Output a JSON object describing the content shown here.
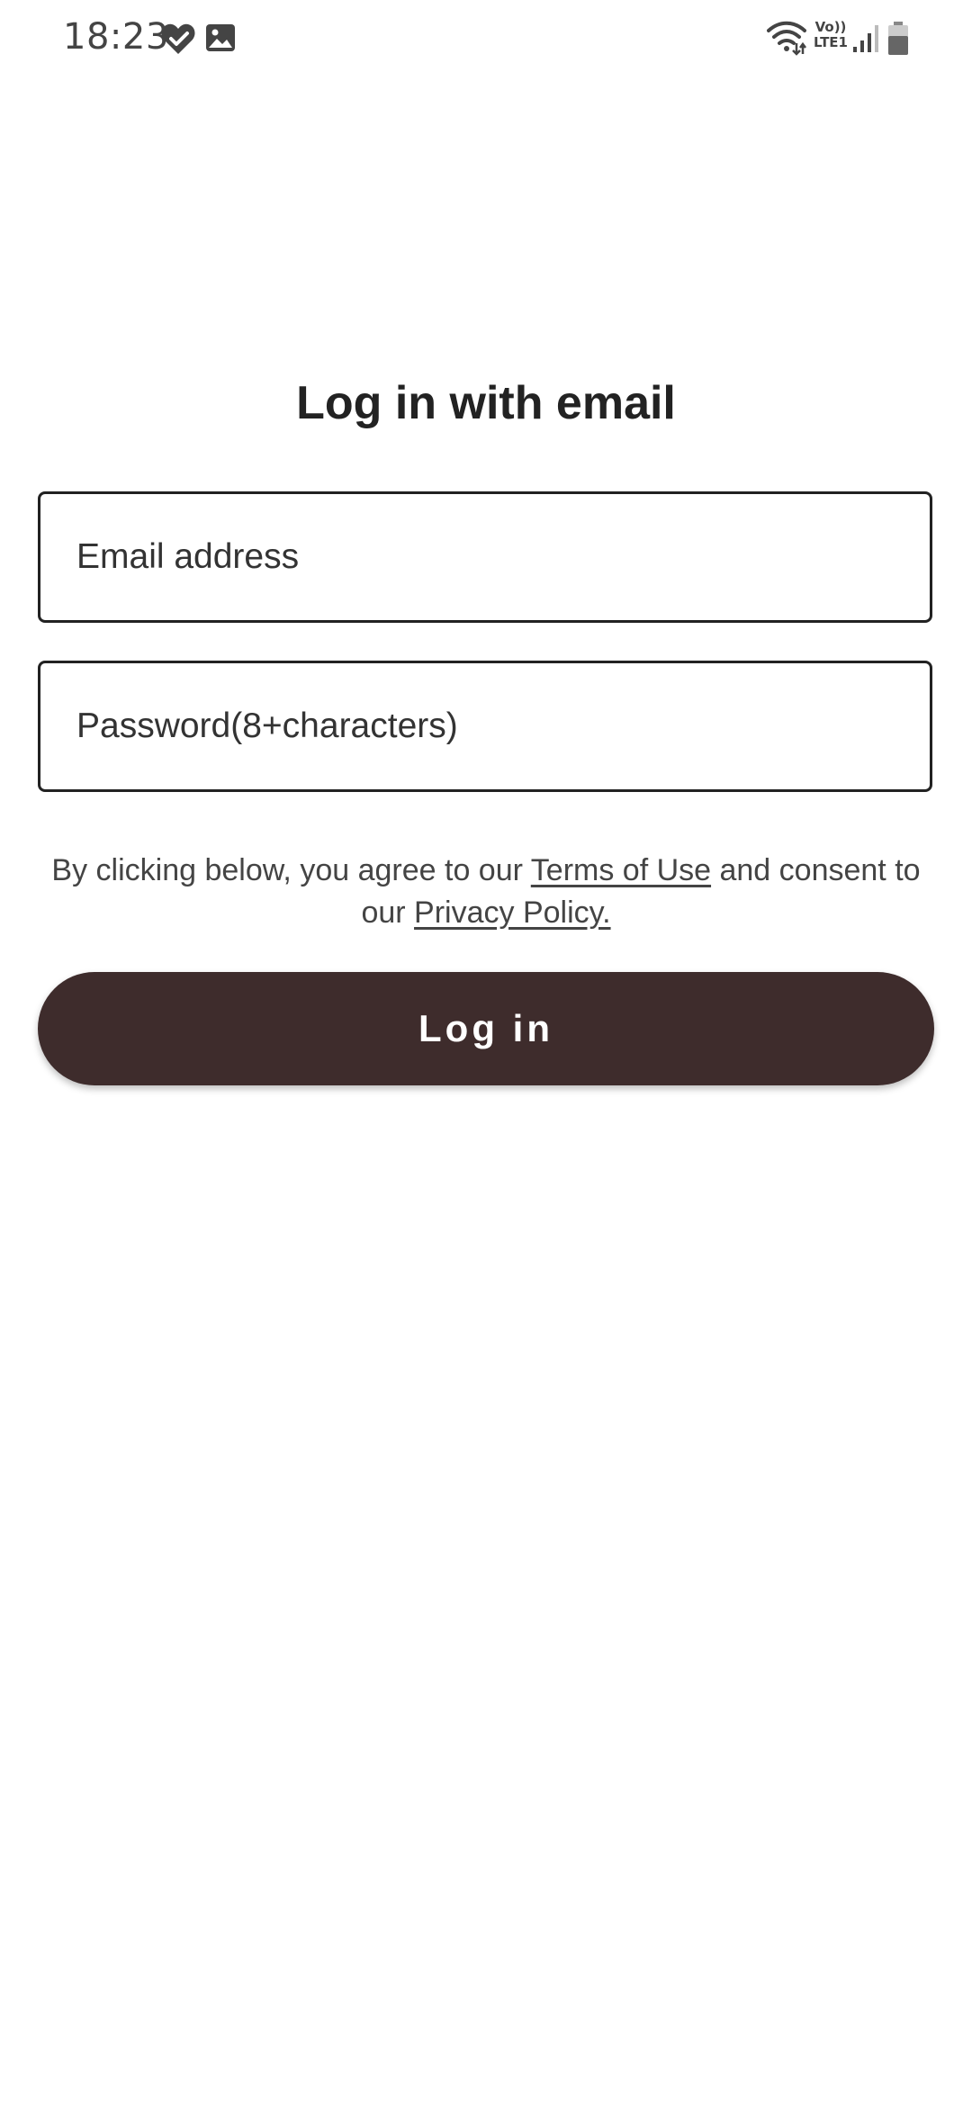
{
  "status_bar": {
    "time": "18:23",
    "icons": [
      "heart-check-icon",
      "gallery-icon",
      "wifi-icon",
      "volte-icon",
      "signal-icon",
      "battery-icon"
    ],
    "volte_top": "Vo))",
    "volte_bottom": "LTE1"
  },
  "login": {
    "title": "Log in with email",
    "email_placeholder": "Email address",
    "email_value": "",
    "password_placeholder": "Password(8+characters)",
    "password_value": "",
    "consent": {
      "before_terms": "By clicking below, you agree to our ",
      "terms_link": "Terms of Use",
      "between": " and consent to our ",
      "privacy_link": "Privacy Policy."
    },
    "button_label": "Log in"
  },
  "colors": {
    "button_background": "#3e2c2c",
    "button_text": "#ffffff",
    "field_border": "#222222",
    "text_primary": "#222222",
    "text_secondary": "#444444"
  }
}
